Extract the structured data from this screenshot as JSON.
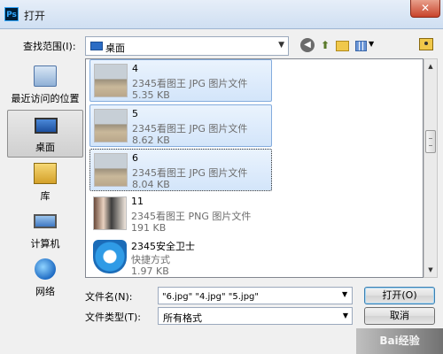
{
  "window": {
    "title": "打开",
    "app_icon_text": "Ps",
    "close_symbol": "✕"
  },
  "toolbar": {
    "lookin_label": "查找范围(I):",
    "lookin_value": "桌面"
  },
  "places": [
    {
      "label": "最近访问的位置",
      "icon": "recent-places-icon",
      "selected": false
    },
    {
      "label": "桌面",
      "icon": "desktop-icon",
      "selected": true
    },
    {
      "label": "库",
      "icon": "library-icon",
      "selected": false
    },
    {
      "label": "计算机",
      "icon": "computer-icon",
      "selected": false
    },
    {
      "label": "网络",
      "icon": "network-icon",
      "selected": false
    }
  ],
  "files": [
    {
      "name": "4",
      "type": "2345看图王 JPG 图片文件",
      "size": "5.35 KB",
      "thumb": "photo",
      "selected": true
    },
    {
      "name": "5",
      "type": "2345看图王 JPG 图片文件",
      "size": "8.62 KB",
      "thumb": "photo",
      "selected": true
    },
    {
      "name": "6",
      "type": "2345看图王 JPG 图片文件",
      "size": "8.04 KB",
      "thumb": "photo",
      "selected": true
    },
    {
      "name": "11",
      "type": "2345看图王 PNG 图片文件",
      "size": "191 KB",
      "thumb": "people",
      "selected": false
    },
    {
      "name": "2345安全卫士",
      "type": "快捷方式",
      "size": "1.97 KB",
      "thumb": "shield",
      "selected": false
    }
  ],
  "form": {
    "filename_label": "文件名(N):",
    "filename_value": "\"6.jpg\" \"4.jpg\" \"5.jpg\"",
    "filetype_label": "文件类型(T):",
    "filetype_value": "所有格式",
    "open_button": "打开(O)",
    "cancel_button": "取消"
  },
  "watermark": "Bai经验"
}
